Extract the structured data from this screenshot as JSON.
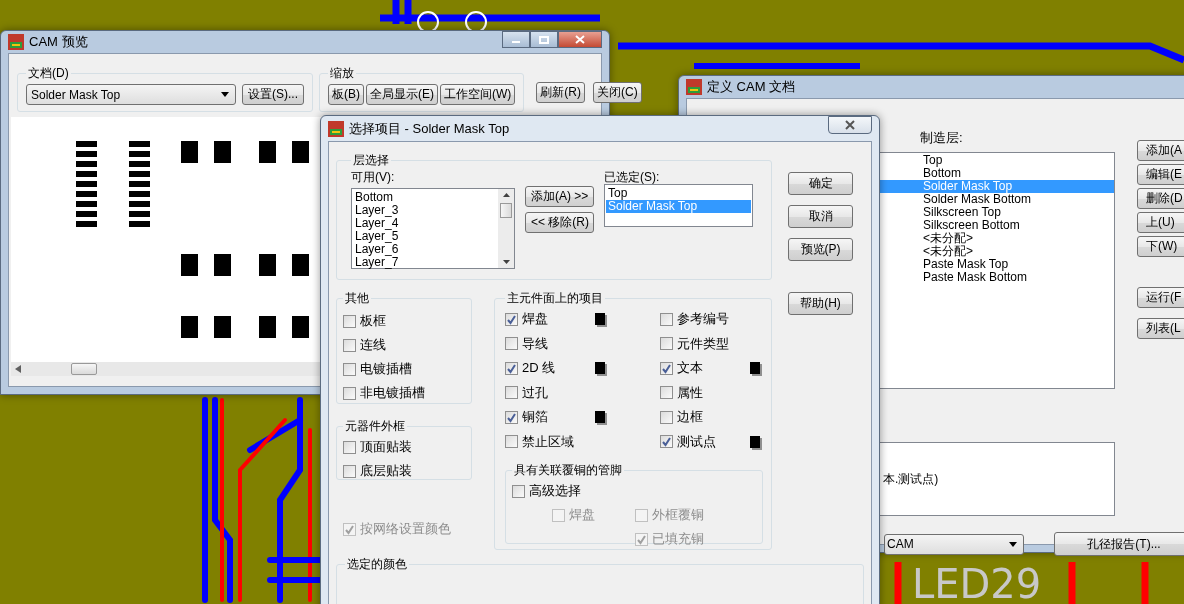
{
  "cam_preview": {
    "title": "CAM 预览",
    "document_group": {
      "label": "文档(D)",
      "combo": "Solder Mask Top",
      "settings_button": "设置(S)..."
    },
    "zoom_group": {
      "label": "缩放",
      "buttons": [
        "板(B)",
        "全局显示(E)",
        "工作空间(W)"
      ]
    },
    "buttons": [
      "刷新(R)",
      "关闭(C)"
    ]
  },
  "define_cam": {
    "title": "定义 CAM 文档",
    "layers_label": "制造层:",
    "layers": [
      {
        "name": "Top",
        "selected": false
      },
      {
        "name": "Bottom",
        "selected": false
      },
      {
        "name": "Solder Mask Top",
        "selected": true
      },
      {
        "name": "Solder Mask Bottom",
        "selected": false
      },
      {
        "name": "Silkscreen Top",
        "selected": false
      },
      {
        "name": "Silkscreen Bottom",
        "selected": false
      },
      {
        "name": "<未分配>",
        "selected": false
      },
      {
        "name": "<未分配>",
        "selected": false
      },
      {
        "name": "Paste Mask Top",
        "selected": false
      },
      {
        "name": "Paste Mask Bottom",
        "selected": false
      }
    ],
    "buttons": [
      "添加(A",
      "编辑(E",
      "删除(D",
      "上(U)",
      "下(W)"
    ],
    "buttons_2": [
      "运行(F",
      "列表(L"
    ],
    "summary": "本.测试点)",
    "combo": "CAM",
    "drill_button": "孔径报告(T)..."
  },
  "select_dialog": {
    "title": "选择项目 - Solder Mask Top",
    "layer_group": {
      "label": "层选择",
      "available_label": "可用(V):",
      "available": [
        "Bottom",
        "Layer_3",
        "Layer_4",
        "Layer_5",
        "Layer_6",
        "Layer_7"
      ],
      "add_button": "添加(A) >>",
      "remove_button": "<< 移除(R)",
      "selected_label": "已选定(S):",
      "selected": [
        {
          "name": "Top",
          "selected": false
        },
        {
          "name": "Solder Mask Top",
          "selected": true
        }
      ]
    },
    "buttons": [
      "确定",
      "取消",
      "预览(P)",
      "帮助(H)"
    ],
    "other_group": {
      "label": "其他",
      "items": [
        {
          "label": "板框",
          "checked": false
        },
        {
          "label": "连线",
          "checked": false
        },
        {
          "label": "电镀插槽",
          "checked": false
        },
        {
          "label": "非电镀插槽",
          "checked": false
        }
      ]
    },
    "outline_group": {
      "label": "元器件外框",
      "items": [
        {
          "label": "顶面贴装",
          "checked": false
        },
        {
          "label": "底层贴装",
          "checked": false
        }
      ]
    },
    "net_color": {
      "label": "按网络设置颜色",
      "checked": true,
      "disabled": true
    },
    "items_group": {
      "label": "主元件面上的项目",
      "items": [
        {
          "label": "焊盘",
          "checked": true
        },
        {
          "label": "参考编号",
          "checked": false
        },
        {
          "label": "导线",
          "checked": false
        },
        {
          "label": "元件类型",
          "checked": false
        },
        {
          "label": "2D 线",
          "checked": true
        },
        {
          "label": "文本",
          "checked": true
        },
        {
          "label": "过孔",
          "checked": false
        },
        {
          "label": "属性",
          "checked": false
        },
        {
          "label": "铜箔",
          "checked": true
        },
        {
          "label": "边框",
          "checked": false
        },
        {
          "label": "禁止区域",
          "checked": false
        },
        {
          "label": "测试点",
          "checked": true
        }
      ]
    },
    "pins_group": {
      "label": "具有关联覆铜的管脚",
      "advanced": {
        "label": "高级选择",
        "checked": false,
        "disabled": false
      },
      "items": [
        {
          "label": "焊盘",
          "checked": false,
          "disabled": true
        },
        {
          "label": "外框覆铜",
          "checked": false,
          "disabled": true
        },
        {
          "label": "已填充铜",
          "checked": true,
          "disabled": true
        }
      ]
    },
    "color_group": {
      "label": "选定的颜色"
    }
  },
  "pcb_label": "LED29"
}
